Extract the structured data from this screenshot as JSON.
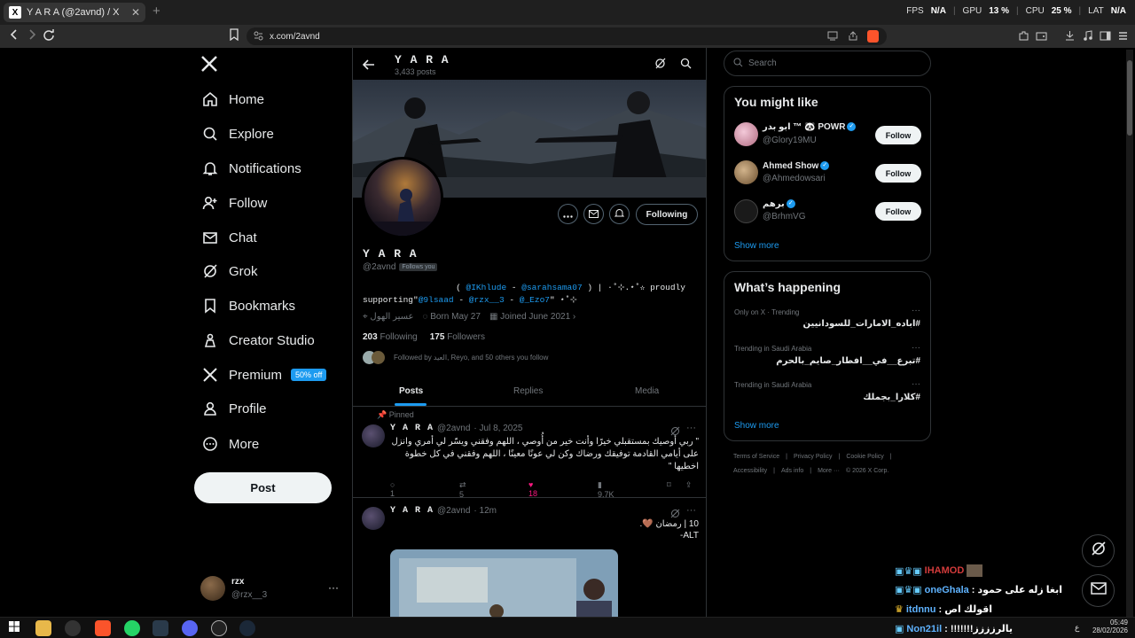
{
  "browser": {
    "tab_title": "Y A R A (@2avnd) / X",
    "tab_favicon": "X",
    "tab_close": "✕",
    "new_tab": "+",
    "url": "x.com/2avnd",
    "stats": {
      "fps_label": "FPS",
      "fps": "N/A",
      "gpu_label": "GPU",
      "gpu": "13 %",
      "cpu_label": "CPU",
      "cpu": "25 %",
      "lat_label": "LAT",
      "lat": "N/A"
    }
  },
  "nav": {
    "logo": "X",
    "items": [
      {
        "label": "Home",
        "icon": "home-icon"
      },
      {
        "label": "Explore",
        "icon": "search-icon"
      },
      {
        "label": "Notifications",
        "icon": "bell-icon"
      },
      {
        "label": "Follow",
        "icon": "add-person-icon"
      },
      {
        "label": "Chat",
        "icon": "mail-icon"
      },
      {
        "label": "Grok",
        "icon": "grok-icon"
      },
      {
        "label": "Bookmarks",
        "icon": "bookmark-icon"
      },
      {
        "label": "Creator Studio",
        "icon": "creator-icon"
      },
      {
        "label": "Premium",
        "icon": "x-icon"
      },
      {
        "label": "Profile",
        "icon": "person-icon"
      },
      {
        "label": "More",
        "icon": "more-circle-icon"
      }
    ],
    "premium_badge": "50% off",
    "post_button": "Post",
    "account": {
      "name": "rzx",
      "handle": "@rzx__3",
      "more": "···"
    }
  },
  "profile": {
    "header_name": "Y A R A",
    "header_posts": "3,433 posts",
    "name": "Y A R A",
    "handle": "@2avnd",
    "follows_you": "Follows you",
    "following_button": "Following",
    "bio_line1_prefix": "( ",
    "bio_mention1": "@IKhlude",
    "bio_dash": " - ",
    "bio_mention2": "@sarahsama07",
    "bio_line1_suffix": " )  | ·˚⊹.⋆˚✫ proudly",
    "bio_line2_prefix": "supporting\"",
    "bio_mention3": "@9lsaad",
    "bio_mention4": "@rzx__3",
    "bio_mention5": "@_Ezo7",
    "bio_line2_suffix": "\" ⋆˚⊹",
    "location": "عسير الهول",
    "born": "Born May 27",
    "joined": "Joined June 2021",
    "following_count": "203",
    "following_label": "Following",
    "followers_count": "175",
    "followers_label": "Followers",
    "followed_by": "Followed by العيد, Reyo, and 50 others you follow",
    "tabs": [
      "Posts",
      "Replies",
      "Media"
    ]
  },
  "posts": [
    {
      "pinned_label": "Pinned",
      "name": "Y A R A",
      "handle": "@2avnd",
      "time": "· Jul 8, 2025",
      "text_lines": [
        "\" ربي أوصيك بمستقبلي خيرًا وأنت خير من أُوصي ، اللهم وفقني ويسّر لي أمري وانزل",
        "على أيامي القادمة توفيقك ورضاك وكن لي عونًا معينًا ، اللهم وفقني في كل خطوة",
        "اخطيها \""
      ],
      "replies": "1",
      "reposts": "5",
      "likes": "18",
      "views": "9.7K"
    },
    {
      "name": "Y A R A",
      "handle": "@2avnd",
      "time": "· 12m",
      "text_lines": [
        "10 | رمضان 🤎.",
        "ALT-"
      ]
    }
  ],
  "right": {
    "search_placeholder": "Search",
    "you_might_like": "You might like",
    "suggestions": [
      {
        "name": "ابو بدر ™ 🐼 POWR",
        "handle": "@Glory19MU",
        "follow": "Follow"
      },
      {
        "name": "Ahmed Show",
        "handle": "@Ahmedowsari",
        "follow": "Follow"
      },
      {
        "name": "برهم",
        "handle": "@BrhmVG",
        "follow": "Follow"
      }
    ],
    "show_more": "Show more",
    "whats_happening": "What’s happening",
    "trends": [
      {
        "context": "Only on X · Trending",
        "tag": "#اباده_الامارات_للسودانيين"
      },
      {
        "context": "Trending in Saudi Arabia",
        "tag": "#تبرع__في__افطار_صايم_بالحرم"
      },
      {
        "context": "Trending in Saudi Arabia",
        "tag": "#كلارا_بجملك"
      }
    ],
    "trend_more": "···",
    "show_more2": "Show more",
    "footer1": [
      "Terms of Service",
      "|",
      "Privacy Policy",
      "|",
      "Cookie Policy",
      "|"
    ],
    "footer2": [
      "Accessibility",
      "|",
      "Ads info",
      "|",
      "More ···",
      "© 2026 X Corp."
    ]
  },
  "overlay_chat": [
    {
      "user": "IHAMOD",
      "msg": "",
      "color": "#d23b3b"
    },
    {
      "user": "oneGhala",
      "msg": "ابغا زله على حمود : ",
      "color": "#5fb3ff"
    },
    {
      "user": "itdnnu",
      "msg": "اقولك اص : ",
      "color": "#5fb3ff"
    },
    {
      "user": "Non21il",
      "msg": "يالرزززز!!!!!!! : ",
      "color": "#5fb3ff"
    }
  ],
  "taskbar": {
    "time": "05:49",
    "date": "28/02/2026",
    "lang": "ع"
  }
}
